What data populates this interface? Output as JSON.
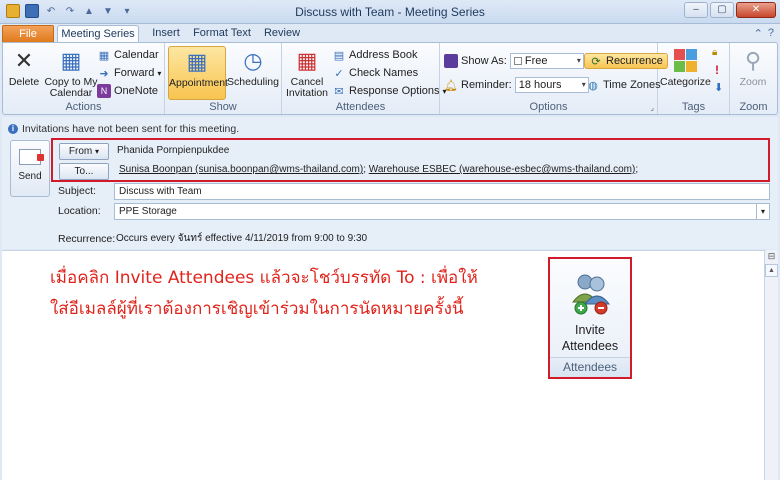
{
  "window": {
    "title": "Discuss with Team  -  Meeting Series",
    "min": "–",
    "max": "▢",
    "close": "✕"
  },
  "tabs": [
    "File",
    "Meeting Series",
    "Insert",
    "Format Text",
    "Review"
  ],
  "ribbon": {
    "actions": {
      "label": "Actions",
      "delete": "Delete",
      "copy_to_calendar_line1": "Copy to My",
      "copy_to_calendar_line2": "Calendar",
      "calendar": "Calendar",
      "forward": "Forward",
      "onenote": "OneNote"
    },
    "show": {
      "label": "Show",
      "appointment": "Appointment",
      "scheduling": "Scheduling"
    },
    "attendees": {
      "label": "Attendees",
      "cancel_line1": "Cancel",
      "cancel_line2": "Invitation",
      "address_book": "Address Book",
      "check_names": "Check Names",
      "response_options": "Response Options"
    },
    "options": {
      "label": "Options",
      "show_as_label": "Show As:",
      "show_as_value": "Free",
      "reminder_label": "Reminder:",
      "reminder_value": "18 hours",
      "recurrence": "Recurrence",
      "time_zones": "Time Zones"
    },
    "tags": {
      "label": "Tags",
      "categorize": "Categorize"
    },
    "zoom": {
      "label": "Zoom",
      "zoom": "Zoom"
    }
  },
  "form": {
    "info_message": "Invitations have not been sent for this meeting.",
    "send": "Send",
    "from_button": "From",
    "from_value": "Phanida Pornpienpukdee",
    "to_button": "To...",
    "to_recipient_1": "Sunisa Boonpan (sunisa.boonpan@wms-thailand.com)",
    "to_recipient_2": "Warehouse ESBEC (warehouse-esbec@wms-thailand.com)",
    "subject_label": "Subject:",
    "subject_value": "Discuss with Team",
    "location_label": "Location:",
    "location_value": "PPE Storage",
    "recurrence_label": "Recurrence:",
    "recurrence_value": "Occurs every จันทร์ effective 4/11/2019 from 9:00 to 9:30"
  },
  "body": {
    "note_line1": "เมื่อคลิก Invite Attendees แล้วจะโชว์บรรทัด To : เพื่อให้",
    "note_line2": "ใส่อีเมลล์ผู้ที่เราต้องการเชิญเข้าร่วมในการนัดหมายครั้งนี้",
    "callout_label_line1": "Invite",
    "callout_label_line2": "Attendees",
    "callout_group": "Attendees"
  },
  "colors": {
    "highlight_border": "#d11a2a",
    "note_text": "#e0241c",
    "file_tab": "#e07a1c"
  }
}
